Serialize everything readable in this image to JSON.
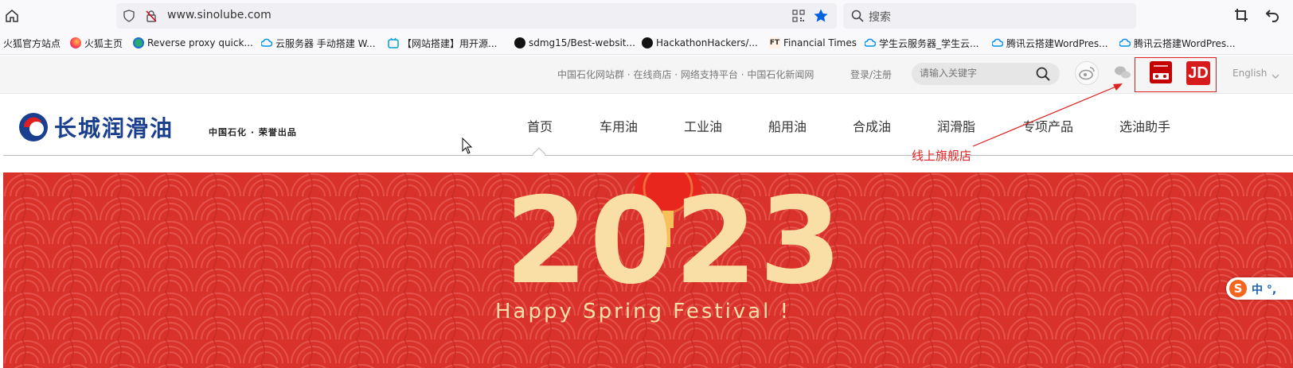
{
  "browser": {
    "url": "www.sinolube.com",
    "search_placeholder": "搜索"
  },
  "bookmarks": [
    {
      "label": "火狐官方站点",
      "icon": "none"
    },
    {
      "label": "火狐主页",
      "icon": "firefox-icon"
    },
    {
      "label": "Reverse proxy quick...",
      "icon": "globe-icon"
    },
    {
      "label": "云服务器 手动搭建 W...",
      "icon": "cloud-icon"
    },
    {
      "label": "【网站搭建】用开源...",
      "icon": "bilibili-icon"
    },
    {
      "label": "sdmg15/Best-websit...",
      "icon": "github-icon"
    },
    {
      "label": "HackathonHackers/...",
      "icon": "github-icon"
    },
    {
      "label": "Financial Times",
      "icon": "ft-icon"
    },
    {
      "label": "学生云服务器_学生云...",
      "icon": "cloud-icon"
    },
    {
      "label": "腾讯云搭建WordPres...",
      "icon": "cloud-icon"
    },
    {
      "label": "腾讯云搭建WordPres...",
      "icon": "cloud-icon"
    }
  ],
  "site_top": {
    "links": "中国石化网站群 · 在线商店 · 网络支持平台 · 中国石化新闻网",
    "login": "登录/注册",
    "search_placeholder": "请输入关键字",
    "language": "English"
  },
  "site_nav": {
    "brand": "长城润滑油",
    "tagline": "中国石化 · 荣誉出品",
    "items": [
      "首页",
      "车用油",
      "工业油",
      "船用油",
      "合成油",
      "润滑脂",
      "专项产品",
      "选油助手"
    ]
  },
  "annotation": {
    "label": "线上旗舰店",
    "color": "#e02020"
  },
  "banner": {
    "year": "2023",
    "subtitle": "Happy Spring Festival !",
    "bg_color": "#d8322b"
  },
  "ime": {
    "label": "中 °,"
  },
  "colors": {
    "brand_blue": "#1a3f8f",
    "brand_red": "#e02020"
  }
}
